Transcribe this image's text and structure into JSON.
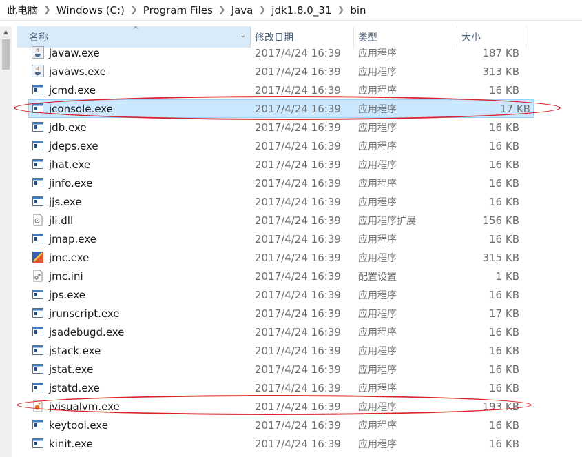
{
  "breadcrumb": [
    "此电脑",
    "Windows (C:)",
    "Program Files",
    "Java",
    "jdk1.8.0_31",
    "bin"
  ],
  "columns": {
    "name": "名称",
    "date": "修改日期",
    "type": "类型",
    "size": "大小"
  },
  "files": [
    {
      "name": "javaw.exe",
      "date": "2017/4/24 16:39",
      "type": "应用程序",
      "size": "187 KB",
      "icon": "java-cup-icon"
    },
    {
      "name": "javaws.exe",
      "date": "2017/4/24 16:39",
      "type": "应用程序",
      "size": "313 KB",
      "icon": "java-cup-icon"
    },
    {
      "name": "jcmd.exe",
      "date": "2017/4/24 16:39",
      "type": "应用程序",
      "size": "16 KB",
      "icon": "exe-window-icon"
    },
    {
      "name": "jconsole.exe",
      "date": "2017/4/24 16:39",
      "type": "应用程序",
      "size": "17 KB",
      "icon": "exe-window-icon",
      "selected": true
    },
    {
      "name": "jdb.exe",
      "date": "2017/4/24 16:39",
      "type": "应用程序",
      "size": "16 KB",
      "icon": "exe-window-icon"
    },
    {
      "name": "jdeps.exe",
      "date": "2017/4/24 16:39",
      "type": "应用程序",
      "size": "16 KB",
      "icon": "exe-window-icon"
    },
    {
      "name": "jhat.exe",
      "date": "2017/4/24 16:39",
      "type": "应用程序",
      "size": "16 KB",
      "icon": "exe-window-icon"
    },
    {
      "name": "jinfo.exe",
      "date": "2017/4/24 16:39",
      "type": "应用程序",
      "size": "16 KB",
      "icon": "exe-window-icon"
    },
    {
      "name": "jjs.exe",
      "date": "2017/4/24 16:39",
      "type": "应用程序",
      "size": "16 KB",
      "icon": "exe-window-icon"
    },
    {
      "name": "jli.dll",
      "date": "2017/4/24 16:39",
      "type": "应用程序扩展",
      "size": "156 KB",
      "icon": "dll-file-icon"
    },
    {
      "name": "jmap.exe",
      "date": "2017/4/24 16:39",
      "type": "应用程序",
      "size": "16 KB",
      "icon": "exe-window-icon"
    },
    {
      "name": "jmc.exe",
      "date": "2017/4/24 16:39",
      "type": "应用程序",
      "size": "315 KB",
      "icon": "jmc-app-icon"
    },
    {
      "name": "jmc.ini",
      "date": "2017/4/24 16:39",
      "type": "配置设置",
      "size": "1 KB",
      "icon": "ini-file-icon"
    },
    {
      "name": "jps.exe",
      "date": "2017/4/24 16:39",
      "type": "应用程序",
      "size": "16 KB",
      "icon": "exe-window-icon"
    },
    {
      "name": "jrunscript.exe",
      "date": "2017/4/24 16:39",
      "type": "应用程序",
      "size": "17 KB",
      "icon": "exe-window-icon"
    },
    {
      "name": "jsadebugd.exe",
      "date": "2017/4/24 16:39",
      "type": "应用程序",
      "size": "16 KB",
      "icon": "exe-window-icon"
    },
    {
      "name": "jstack.exe",
      "date": "2017/4/24 16:39",
      "type": "应用程序",
      "size": "16 KB",
      "icon": "exe-window-icon"
    },
    {
      "name": "jstat.exe",
      "date": "2017/4/24 16:39",
      "type": "应用程序",
      "size": "16 KB",
      "icon": "exe-window-icon"
    },
    {
      "name": "jstatd.exe",
      "date": "2017/4/24 16:39",
      "type": "应用程序",
      "size": "16 KB",
      "icon": "exe-window-icon"
    },
    {
      "name": "jvisualvm.exe",
      "date": "2017/4/24 16:39",
      "type": "应用程序",
      "size": "193 KB",
      "icon": "visualvm-app-icon"
    },
    {
      "name": "keytool.exe",
      "date": "2017/4/24 16:39",
      "type": "应用程序",
      "size": "16 KB",
      "icon": "exe-window-icon"
    },
    {
      "name": "kinit.exe",
      "date": "2017/4/24 16:39",
      "type": "应用程序",
      "size": "16 KB",
      "icon": "exe-window-icon"
    }
  ],
  "colors": {
    "selection_bg": "#cce8ff",
    "selection_border": "#99d1ff",
    "header_active_bg": "#d9ebf9",
    "annotation_red": "#d9252a"
  }
}
